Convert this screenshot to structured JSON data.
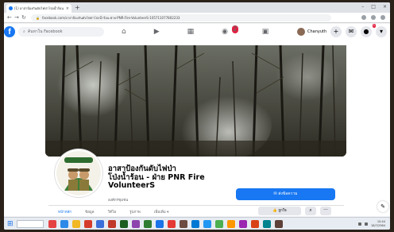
{
  "browser": {
    "tab_title": "(1) อาสาป้องกันดับไฟป่าโป่งน้ำร้อน - ฝ่าย PNR Fire Volunte...",
    "tab_close": "×",
    "new_tab": "+",
    "url": "facebook.com/อาสาป้องกันดับไฟป่าโป่งน้ำร้อน-ฝ่าย-PNR-Fire-VolunteerS-105711077802233",
    "window_controls": [
      "–",
      "□",
      "×"
    ]
  },
  "facebook": {
    "logo": "f",
    "search_placeholder": "ค้นหาใน Facebook",
    "nav_icons": [
      "home-icon",
      "watch-icon",
      "marketplace-icon",
      "groups-icon",
      "gaming-icon"
    ],
    "groups_badge": "2",
    "user_name": "Chanyuth",
    "notif_badge": "1",
    "messenger_label": "💬"
  },
  "page": {
    "title_line1": "อาสาป้องกันดับไฟป่า",
    "title_line2": "โป่งน้ำร้อน - ฝ่าย PNR Fire",
    "title_line3": "VolunteerS",
    "category": "องค์กรชุมชน",
    "send_message": "ส่งข้อความ",
    "tabs": [
      "หน้าหลัก",
      "ข้อมูล",
      "วิดีโอ",
      "รูปภาพ",
      "เพิ่มเติม ▾"
    ],
    "like_button": "ถูกใจ",
    "search_btn": "⌕",
    "more_btn": "···"
  },
  "taskbar": {
    "time": "10:44",
    "date": "18/7/2564",
    "icon_colors": [
      "#e54242",
      "#2d8ae8",
      "#f2b824",
      "#d53b2c",
      "#3b6ed8",
      "#c0392b",
      "#1b5e20",
      "#8e44ad",
      "#2e7d32",
      "#1a73e8",
      "#e53935",
      "#6d4c41",
      "#0078d4",
      "#2196f3",
      "#4caf50",
      "#ff9800",
      "#9c27b0",
      "#d84315",
      "#00838f",
      "#5d4037"
    ]
  },
  "colors": {
    "brand": "#1877f2",
    "badge": "#e41e3f"
  }
}
